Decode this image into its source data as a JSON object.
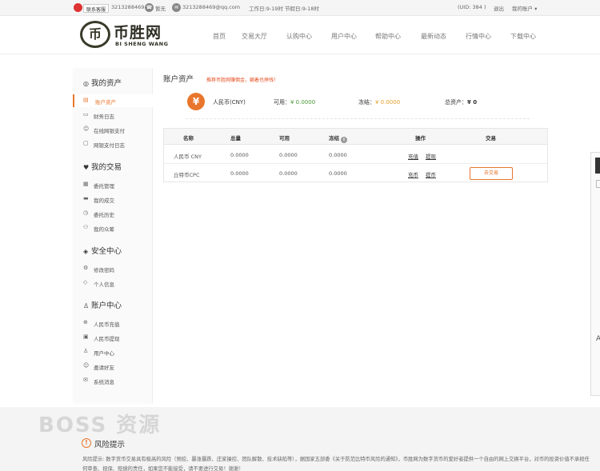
{
  "topbar": {
    "contact_label": "联系客服",
    "qq_number": "3213288469",
    "phone_label": "暂无",
    "email": "3213288469@qq.com",
    "work_hours": "工作日:9-19时 节假日:9-18时",
    "uid": "(UID: 384 )",
    "logout": "退出",
    "my_account": "我的账户"
  },
  "logo": {
    "mark": "币",
    "cn": "币胜网",
    "en": "BI SHENG WANG"
  },
  "nav": [
    "首页",
    "交易大厅",
    "认购中心",
    "用户中心",
    "帮助中心",
    "最新动态",
    "行情中心",
    "下载中心"
  ],
  "sidebar": {
    "sections": [
      {
        "title": "我的资产",
        "icon": "asset-icon",
        "items": [
          {
            "label": "账户资产",
            "active": true
          },
          {
            "label": "财务日志"
          },
          {
            "label": "在线网银支付"
          },
          {
            "label": "网银支付日志"
          }
        ]
      },
      {
        "title": "我的交易",
        "icon": "trade-icon",
        "items": [
          {
            "label": "委托管理"
          },
          {
            "label": "我的成交"
          },
          {
            "label": "委托历史"
          },
          {
            "label": "我的众筹"
          }
        ]
      },
      {
        "title": "安全中心",
        "icon": "shield-icon",
        "items": [
          {
            "label": "修改密码"
          },
          {
            "label": "个人信息"
          }
        ]
      },
      {
        "title": "账户中心",
        "icon": "user-icon",
        "items": [
          {
            "label": "人民币充值"
          },
          {
            "label": "人民币提现"
          },
          {
            "label": "用户中心"
          },
          {
            "label": "邀请好友"
          },
          {
            "label": "系统消息"
          }
        ]
      }
    ]
  },
  "main": {
    "title": "账户资产",
    "notice": "推荐币胜网赚佣金，躺着也挣钱！",
    "summary": {
      "currency": "人民币(CNY)",
      "available_label": "可用：",
      "available_value": "¥ 0.0000",
      "frozen_label": "冻结：",
      "frozen_value": "¥ 0.0000",
      "total_label": "总资产：",
      "total_value": "¥ 0"
    },
    "table": {
      "headers": [
        "名称",
        "总量",
        "可用",
        "冻结",
        "操作",
        "交易"
      ],
      "rows": [
        {
          "name": "人民币 CNY",
          "total": "0.0000",
          "available": "0.0000",
          "frozen": "0.0000",
          "op1": "充值",
          "op2": "提现",
          "trade": ""
        },
        {
          "name": "丘特币CPC",
          "total": "0.0000",
          "available": "0.0000",
          "frozen": "0.0000",
          "op1": "充币",
          "op2": "提币",
          "trade": "去交易"
        }
      ]
    }
  },
  "footer": {
    "watermark": "BOSS 资源",
    "risk_title": "风险提示",
    "risk_text": "风险提示: 数字货币交易具有极高的风险（预挖、暴涨暴跌、庄家操控、团队解散、技术缺陷等），据国家五部委《关于防范比特币风险的通知》，币胜网为数字货币的爱好者提供一个自由的网上交换平台，对币的投资价值不承担任何审查、担保、赔偿的责任，如果您不能接受，请不要进行交易！谢谢！"
  },
  "colors": {
    "accent": "#e8762c",
    "notice": "#e64c1e",
    "green": "#4a9a3a"
  }
}
